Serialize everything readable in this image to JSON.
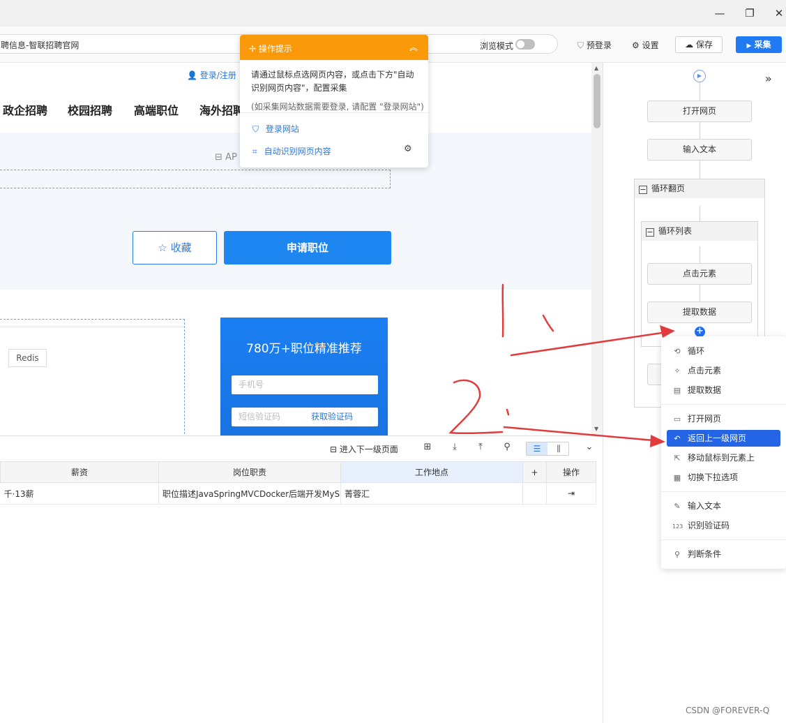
{
  "window": {
    "minimize_glyph": "—",
    "maximize_glyph": "❐",
    "close_glyph": "✕"
  },
  "toolbar": {
    "url_text": "聘信息-智联招聘官网",
    "browse_mode_label": "浏览模式",
    "pre_login_label": "预登录",
    "settings_label": "设置",
    "save_label": "保存",
    "collect_label": "采集"
  },
  "webpage": {
    "login_link": "登录/注册",
    "nav_items": [
      "政企招聘",
      "校园招聘",
      "高端职位",
      "海外招聘"
    ],
    "ap_text": "AP",
    "favorite_label": "收藏",
    "apply_label": "申请职位",
    "skill_tag": "Redis",
    "promo_title": "780万+职位精准推荐",
    "phone_placeholder": "手机号",
    "sms_placeholder": "短信验证码",
    "get_code_label": "获取验证码"
  },
  "tip": {
    "title": "操作提示",
    "body": "请通过鼠标点选网页内容，或点击下方\"自动识别网页内容\"，配置采集",
    "note": "(如采集网站数据需要登录, 请配置 \"登录网站\")",
    "login_site_label": "登录网站",
    "auto_detect_label": "自动识别网页内容"
  },
  "panel": {
    "next_page_label": "进入下一级页面",
    "columns": [
      "薪资",
      "岗位职责",
      "工作地点",
      "+",
      "操作"
    ],
    "rows": [
      {
        "salary": "千·13薪",
        "duty": "职位描述JavaSpringMVCDocker后端开发MyS...",
        "location": "菁蓉汇"
      }
    ]
  },
  "flow": {
    "nodes": {
      "open_page": "打开网页",
      "input_text": "输入文本",
      "loop_page": "循环翻页",
      "loop_list": "循环列表",
      "click_element": "点击元素",
      "extract_data": "提取数据"
    },
    "expand_glyph": "»"
  },
  "menu": {
    "groups": [
      [
        {
          "icon": "⟲",
          "label": "循环"
        },
        {
          "icon": "✧",
          "label": "点击元素"
        },
        {
          "icon": "▤",
          "label": "提取数据"
        }
      ],
      [
        {
          "icon": "▭",
          "label": "打开网页"
        },
        {
          "icon": "↶",
          "label": "返回上一级网页",
          "selected": true
        },
        {
          "icon": "⇱",
          "label": "移动鼠标到元素上"
        },
        {
          "icon": "▦",
          "label": "切换下拉选项"
        }
      ],
      [
        {
          "icon": "✎",
          "label": "输入文本"
        },
        {
          "icon": "123",
          "label": "识别验证码"
        }
      ],
      [
        {
          "icon": "⚲",
          "label": "判断条件"
        }
      ]
    ]
  },
  "watermark": "CSDN @FOREVER-Q",
  "annotation_color": "#e23b3b",
  "accent_color": "#1f7af4",
  "tip_header_color": "#fa9a0a"
}
